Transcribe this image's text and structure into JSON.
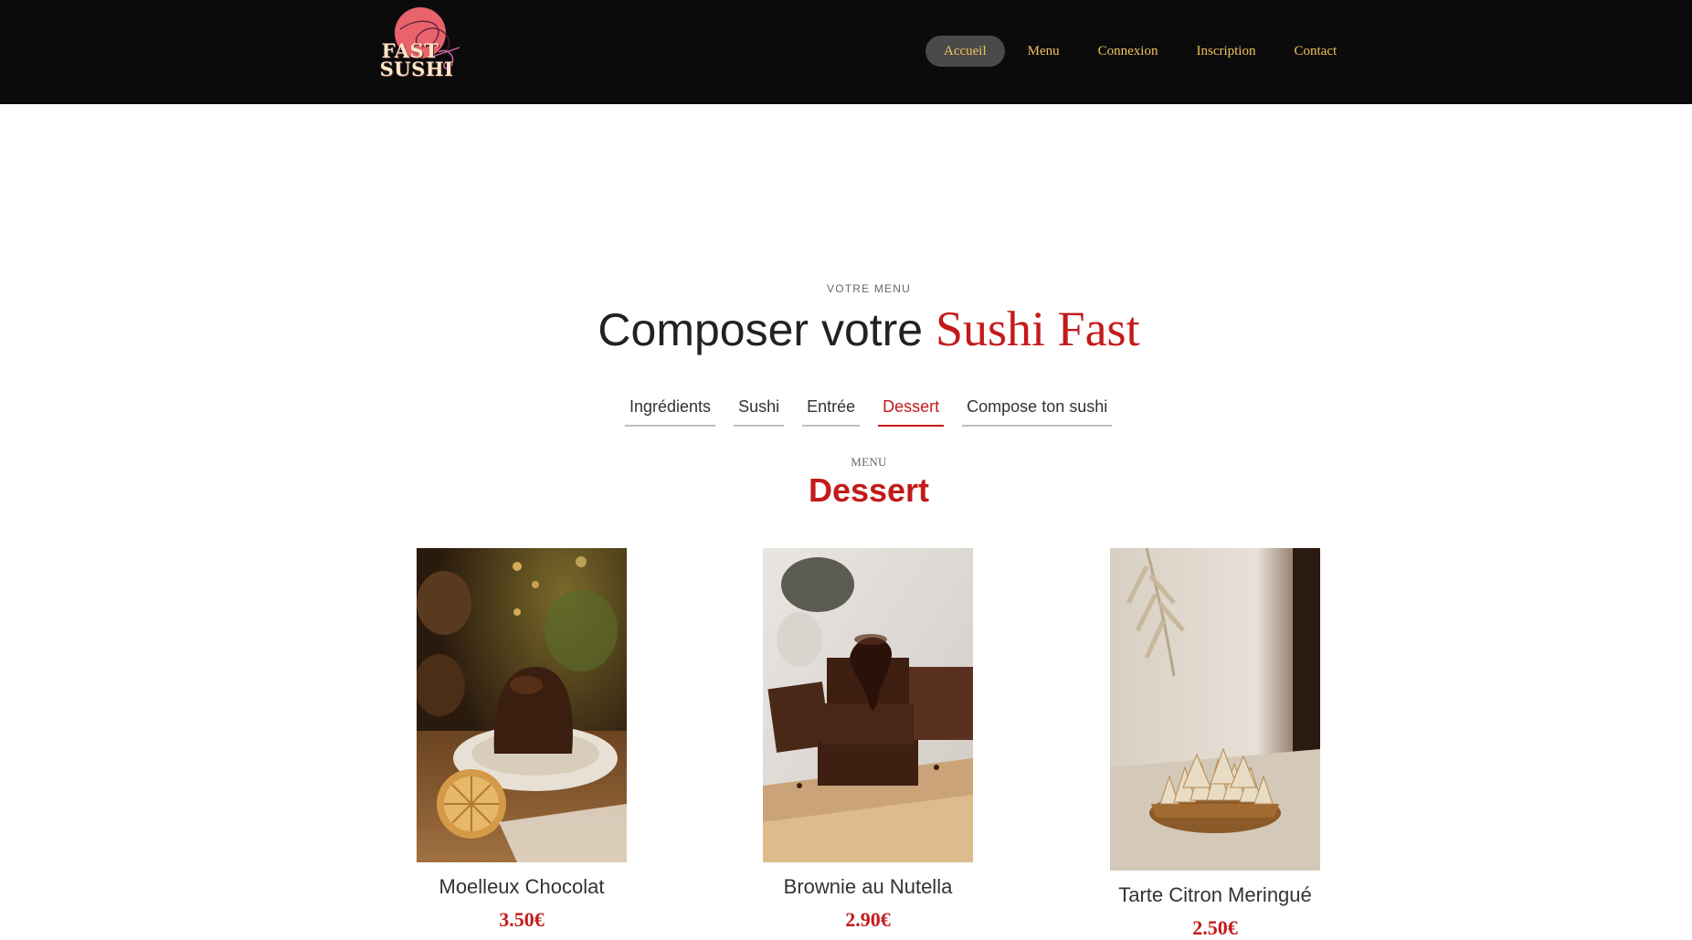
{
  "brand": {
    "logo_line1": "FAST",
    "logo_line2": "SUSHI"
  },
  "nav": {
    "items": [
      "Accueil",
      "Menu",
      "Connexion",
      "Inscription",
      "Contact"
    ],
    "active": "Accueil"
  },
  "hero": {
    "kicker": "VOTRE MENU",
    "title_plain": "Composer votre ",
    "title_accent": "Sushi Fast"
  },
  "tabs": {
    "items": [
      "Ingrédients",
      "Sushi",
      "Entrée",
      "Dessert",
      "Compose ton sushi"
    ],
    "active": "Dessert"
  },
  "section": {
    "kicker": "MENU",
    "title": "Dessert"
  },
  "products": [
    {
      "name": "Moelleux Chocolat",
      "price": "3.50€"
    },
    {
      "name": "Brownie au Nutella",
      "price": "2.90€"
    },
    {
      "name": "Tarte Citron Meringué",
      "price": "2.50€"
    }
  ],
  "colors": {
    "accent": "#c41a1a",
    "nav_bg": "#0b0b0b",
    "nav_link": "#f1c35b"
  }
}
